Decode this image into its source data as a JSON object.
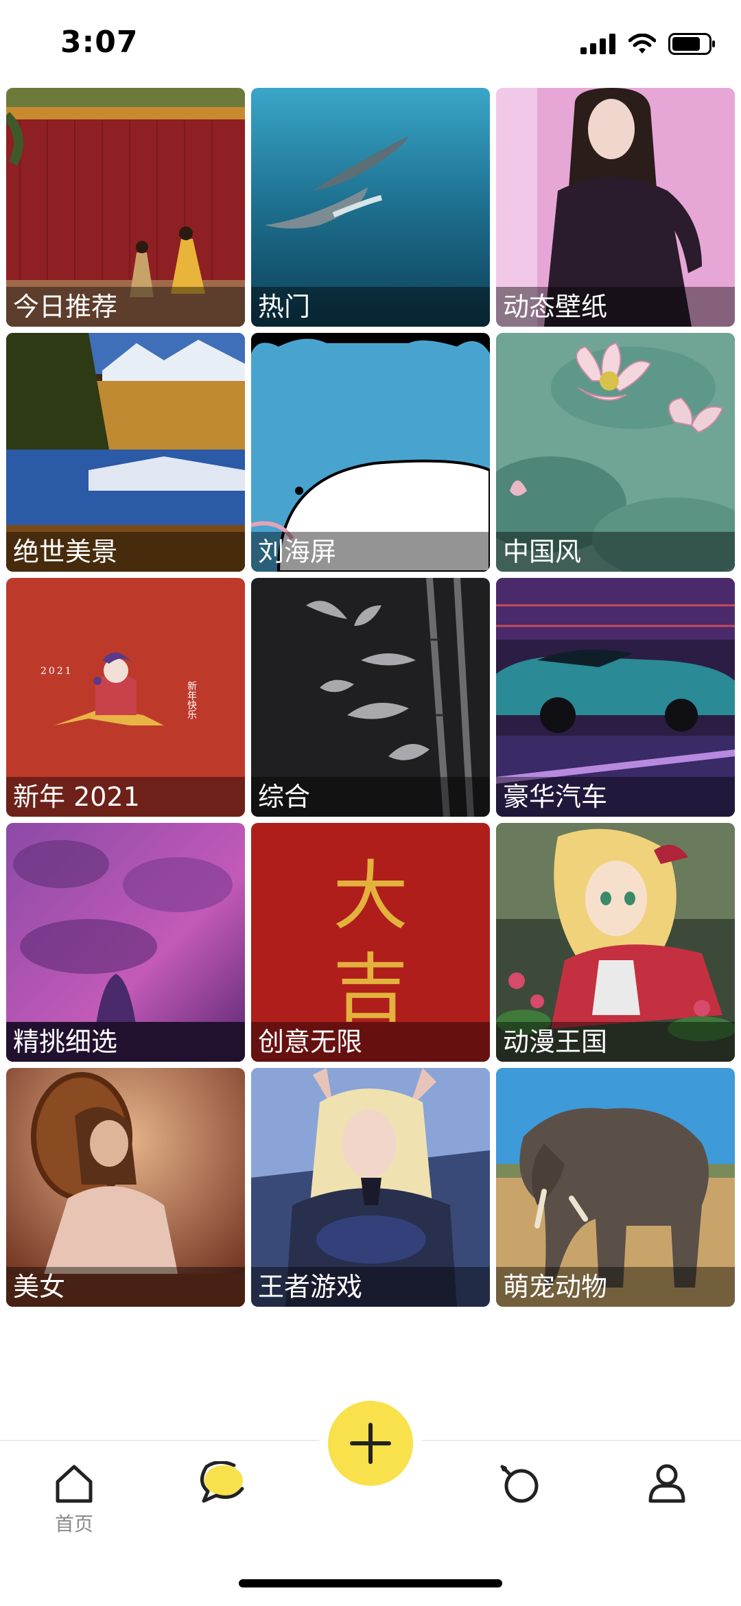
{
  "status_bar": {
    "time": "3:07"
  },
  "categories": [
    {
      "label": "今日推荐",
      "art": "palace-wall"
    },
    {
      "label": "热门",
      "art": "dolphins"
    },
    {
      "label": "动态壁纸",
      "art": "girl-portrait"
    },
    {
      "label": "绝世美景",
      "art": "lake-landscape"
    },
    {
      "label": "刘海屏",
      "art": "cartoon-bear"
    },
    {
      "label": "中国风",
      "art": "lotus"
    },
    {
      "label": "新年 2021",
      "art": "new-year"
    },
    {
      "label": "综合",
      "art": "bamboo"
    },
    {
      "label": "豪华汽车",
      "art": "sports-car"
    },
    {
      "label": "精挑细选",
      "art": "purple-fantasy"
    },
    {
      "label": "创意无限",
      "art": "daji-calligraphy"
    },
    {
      "label": "动漫王国",
      "art": "anime-girl"
    },
    {
      "label": "美女",
      "art": "woman-mirror"
    },
    {
      "label": "王者游戏",
      "art": "game-heroine"
    },
    {
      "label": "萌宠动物",
      "art": "elephant"
    }
  ],
  "calligraphy": {
    "line1": "大",
    "line2": "吉"
  },
  "new_year_art": {
    "year": "2021",
    "greeting": "新年快乐"
  },
  "tab_bar": {
    "home_label": "首页",
    "items": [
      "home-icon",
      "chat-icon",
      "add-icon",
      "discover-icon",
      "profile-icon"
    ]
  },
  "colors": {
    "accent": "#f8e14a",
    "label_overlay": "rgba(0,0,0,0.42)"
  }
}
